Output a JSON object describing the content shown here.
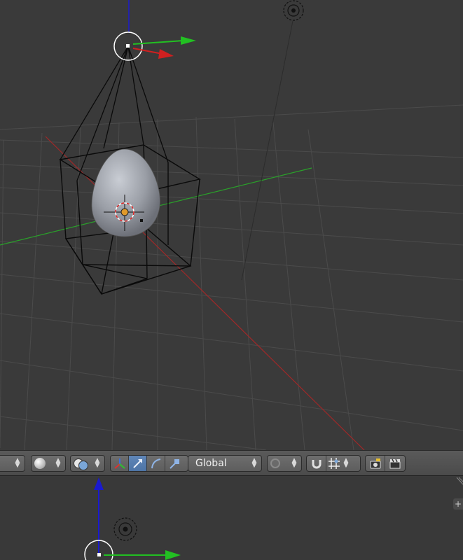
{
  "header": {
    "orientation_value": "Global",
    "buttons": {
      "viewport_shading": "viewport-shading",
      "render_overlay": "overlays",
      "manipulator_translate": "translate",
      "manipulator_rotate": "rotate",
      "manipulator_scale": "scale",
      "proportional_edit": "proportional-edit",
      "snap": "magnet",
      "snap_element": "snap-increment",
      "render_still": "render-image",
      "render_anim": "render-animation"
    }
  },
  "viewport_bottom": {
    "side_tab_label": "+"
  },
  "colors": {
    "x_axis": "#d02020",
    "y_axis": "#20c020",
    "z_axis": "#2020e0",
    "active_tool": "#5a80b2",
    "background": "#3a3a3a"
  }
}
